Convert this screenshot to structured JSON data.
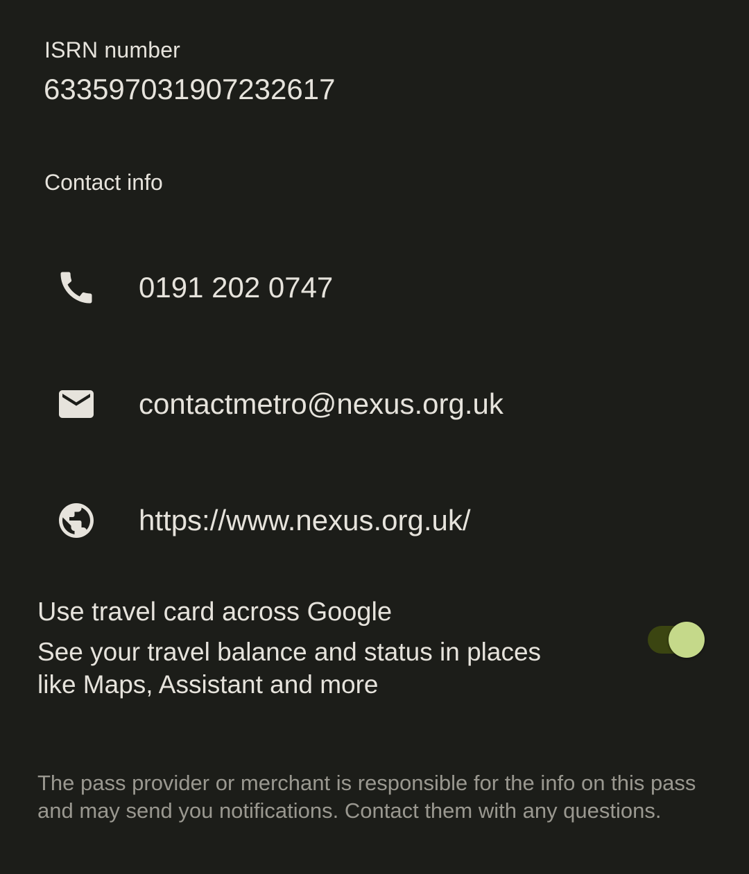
{
  "isrn": {
    "label": "ISRN number",
    "value": "633597031907232617"
  },
  "contact": {
    "title": "Contact info",
    "items": [
      {
        "icon": "phone-icon",
        "value": "0191 202 0747"
      },
      {
        "icon": "email-icon",
        "value": "contactmetro@nexus.org.uk"
      },
      {
        "icon": "globe-icon",
        "value": "https://www.nexus.org.uk/"
      }
    ]
  },
  "travel_card_toggle": {
    "title": "Use travel card across Google",
    "description": "See your travel balance and status in places like Maps, Assistant and more",
    "enabled": true,
    "track_color": "#3b4511",
    "thumb_color": "#c5d98a"
  },
  "disclaimer": "The pass provider or merchant is responsible for the info on this pass and may send you notifications. Contact them with any questions.",
  "colors": {
    "background": "#1c1d19",
    "text": "#e6e3dc",
    "muted_text": "#9a9890"
  }
}
